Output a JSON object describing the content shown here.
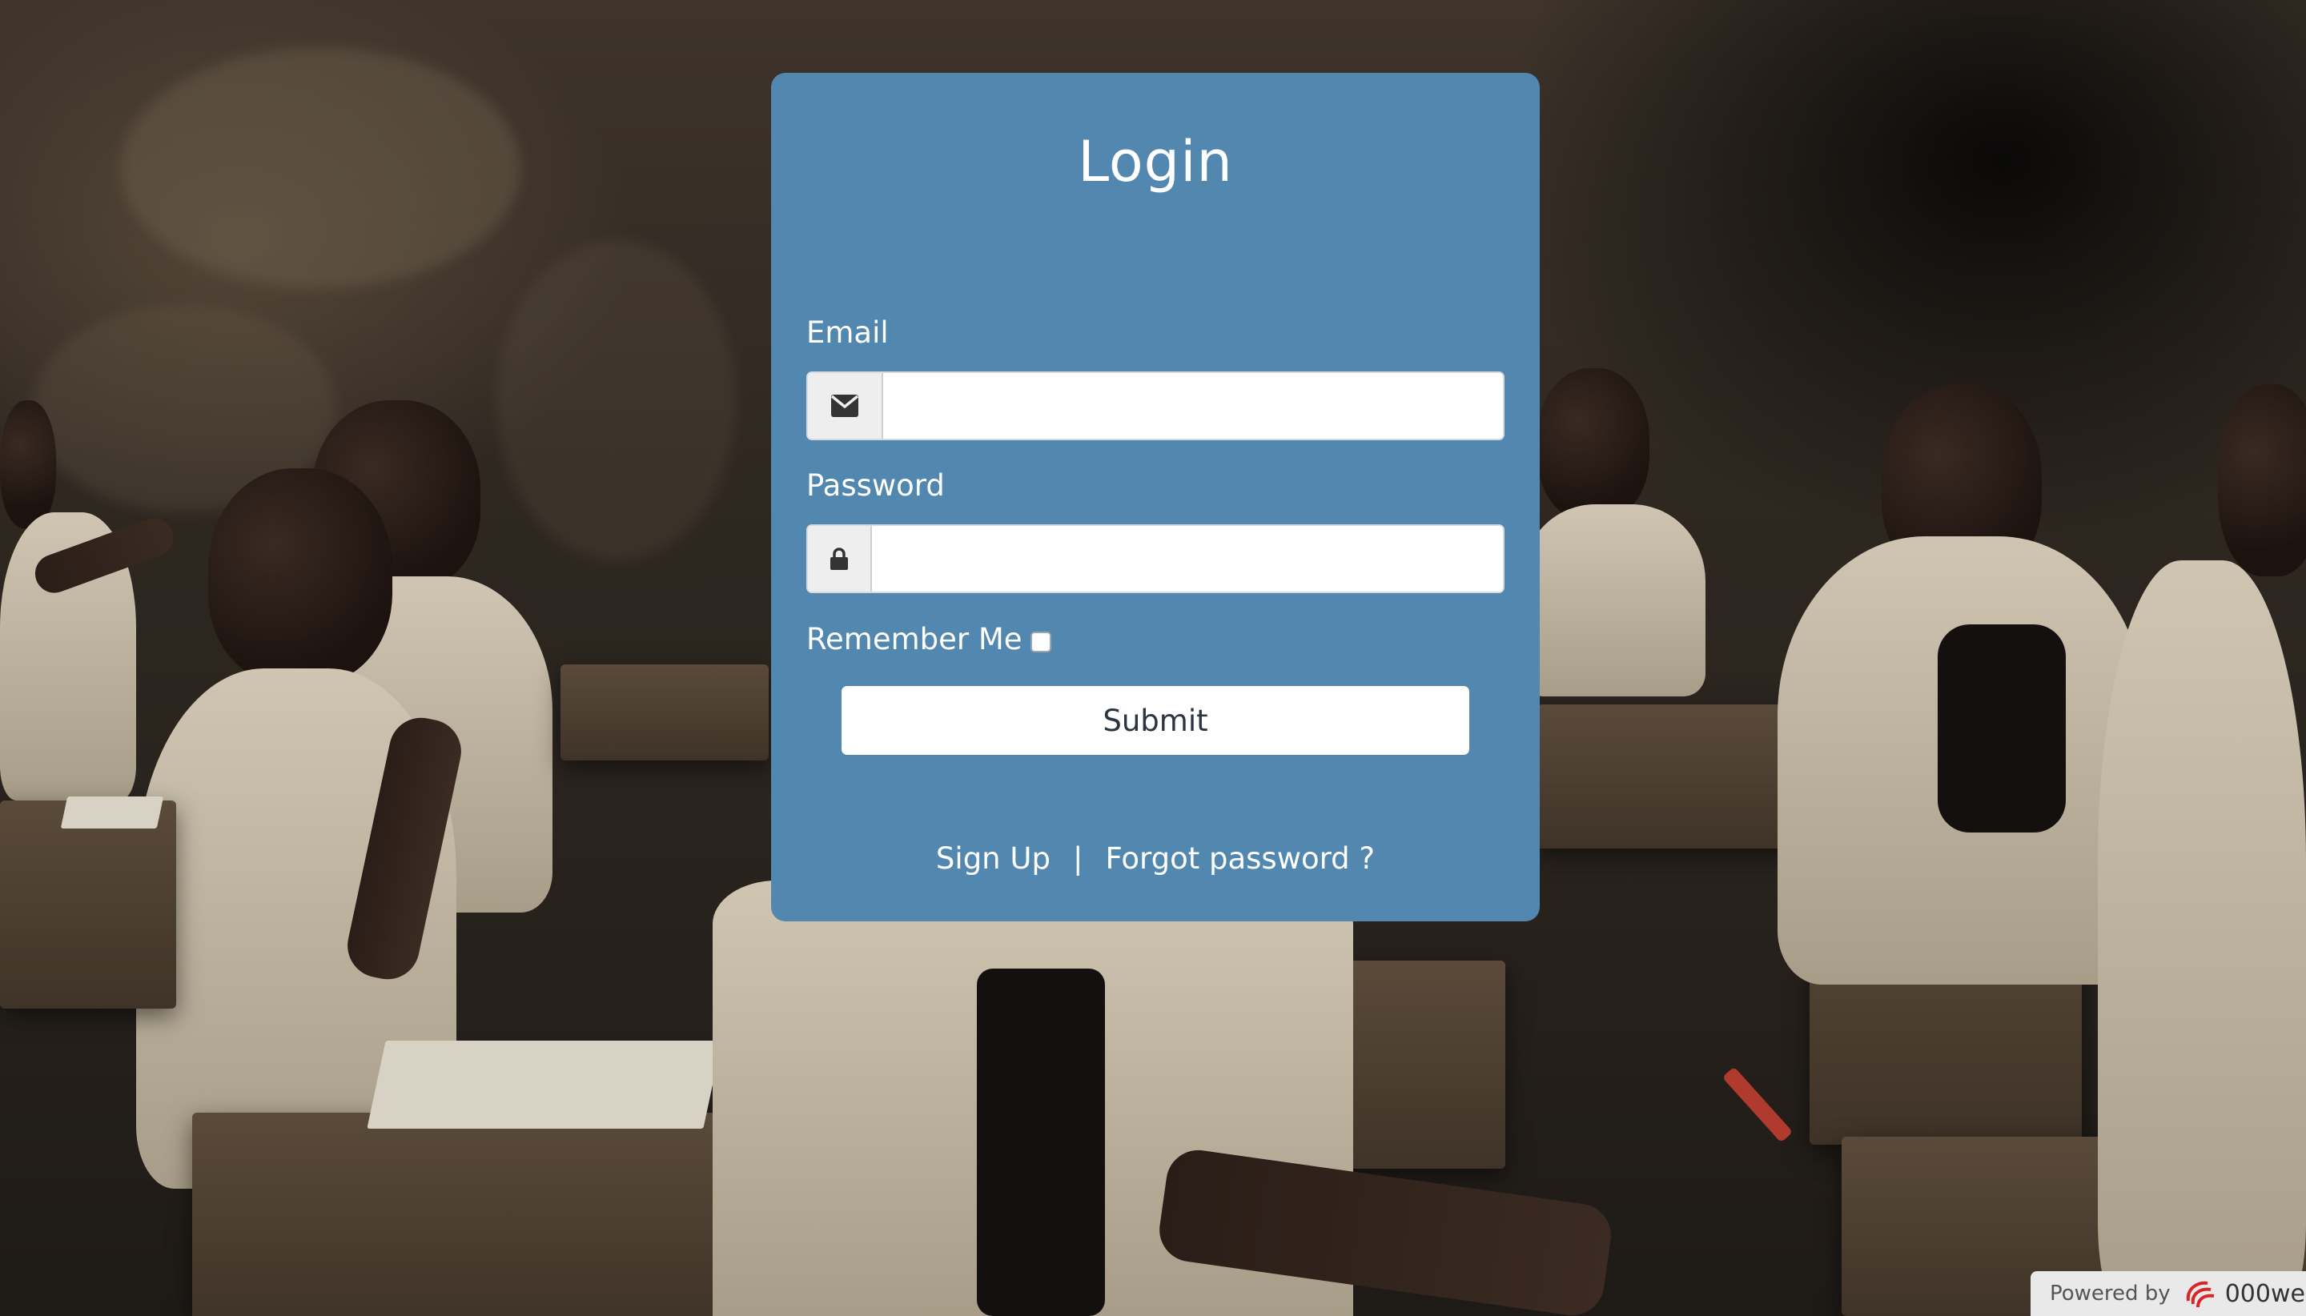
{
  "login": {
    "title": "Login",
    "email_label": "Email",
    "email_value": "",
    "password_label": "Password",
    "password_value": "",
    "remember_label": "Remember Me",
    "remember_checked": false,
    "submit_label": "Submit",
    "signup_label": "Sign Up",
    "separator": "|",
    "forgot_label": "Forgot password ?"
  },
  "footer": {
    "powered_label": "Powered by",
    "brand_text": "000we"
  },
  "colors": {
    "card_background": "#5287b0",
    "button_background": "#ffffff",
    "text": "#ffffff"
  },
  "icons": {
    "email": "envelope-icon",
    "password": "lock-icon",
    "brand": "000webhost-logo-icon"
  }
}
